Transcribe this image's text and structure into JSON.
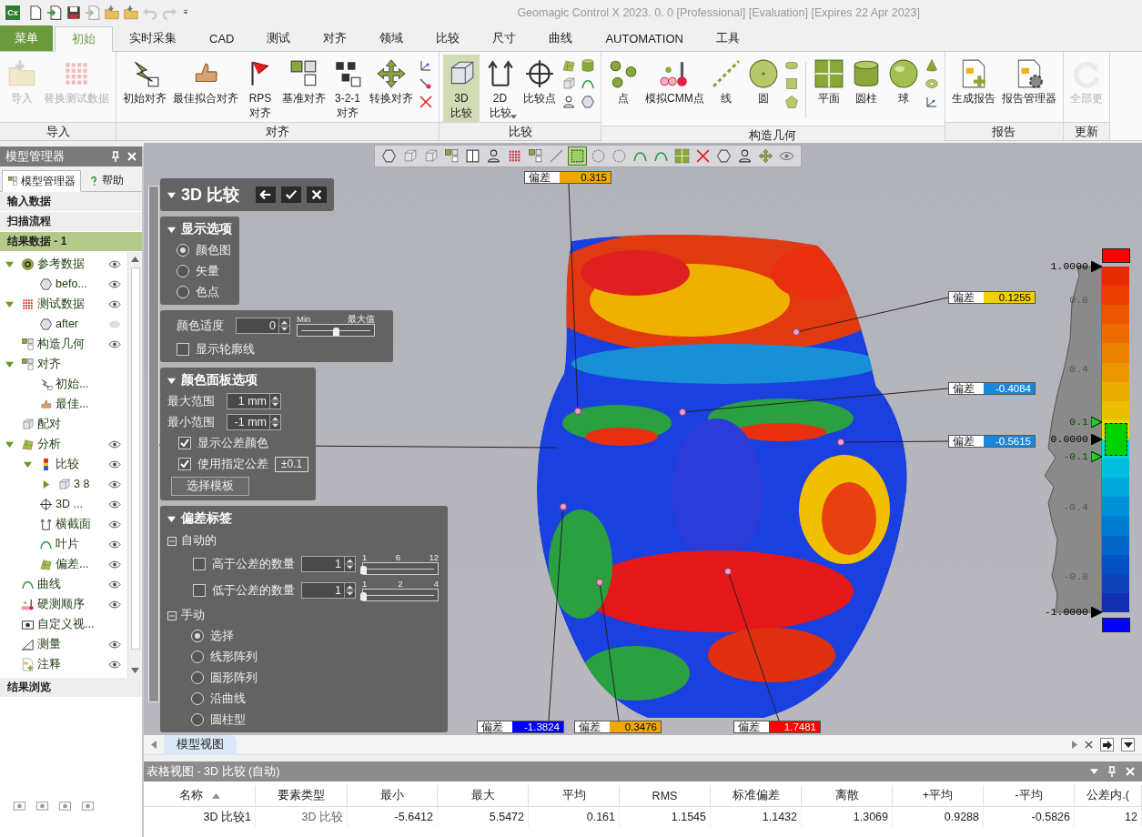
{
  "window": {
    "title": "Geomagic Control X 2023. 0. 0 [Professional] [Evaluation] [Expires 22 Apr 2023]",
    "logo": "Cx"
  },
  "quick_access": [
    {
      "disabled": false
    },
    {
      "disabled": false
    },
    {
      "disabled": false
    },
    {
      "disabled": true
    },
    {
      "disabled": false
    },
    {
      "disabled": false
    },
    {
      "disabled": true
    },
    {
      "disabled": true
    },
    {
      "disabled": false
    }
  ],
  "menu_tabs": [
    {
      "label": "菜单",
      "kind": "menu",
      "selected": false
    },
    {
      "label": "初始",
      "kind": "tab",
      "selected": true
    },
    {
      "label": "实时采集",
      "kind": "tab",
      "selected": false
    },
    {
      "label": "CAD",
      "kind": "tab",
      "selected": false
    },
    {
      "label": "测试",
      "kind": "tab",
      "selected": false
    },
    {
      "label": "对齐",
      "kind": "tab",
      "selected": false
    },
    {
      "label": "领域",
      "kind": "tab",
      "selected": false
    },
    {
      "label": "比较",
      "kind": "tab",
      "selected": false
    },
    {
      "label": "尺寸",
      "kind": "tab",
      "selected": false
    },
    {
      "label": "曲线",
      "kind": "tab",
      "selected": false
    },
    {
      "label": "AUTOMATION",
      "kind": "tab",
      "selected": false
    },
    {
      "label": "工具",
      "kind": "tab",
      "selected": false
    }
  ],
  "ribbon": [
    {
      "title": "导入",
      "items": [
        {
          "kind": "button",
          "label": "导入",
          "disabled": true,
          "selected": false,
          "dropdown": false
        },
        {
          "kind": "button",
          "label": "替换测试数据",
          "disabled": true,
          "selected": false,
          "dropdown": false
        }
      ]
    },
    {
      "title": "对齐",
      "items": [
        {
          "kind": "button",
          "label": "初始对齐",
          "disabled": false,
          "selected": false,
          "dropdown": false
        },
        {
          "kind": "button",
          "label": "最佳拟合对齐",
          "disabled": false,
          "selected": false,
          "dropdown": false
        },
        {
          "kind": "button",
          "label": "RPS\n对齐",
          "disabled": false,
          "selected": false,
          "dropdown": false
        },
        {
          "kind": "button",
          "label": "基准对齐",
          "disabled": false,
          "selected": false,
          "dropdown": false
        },
        {
          "kind": "button",
          "label": "3-2-1\n对齐",
          "disabled": false,
          "selected": false,
          "dropdown": false
        },
        {
          "kind": "button",
          "label": "转换对齐",
          "disabled": false,
          "selected": false,
          "dropdown": false
        },
        {
          "kind": "stack"
        }
      ]
    },
    {
      "title": "比较",
      "items": [
        {
          "kind": "button",
          "label": "3D\n比较",
          "disabled": false,
          "selected": true,
          "dropdown": false
        },
        {
          "kind": "button",
          "label": "2D\n比较",
          "disabled": false,
          "selected": false,
          "dropdown": true
        },
        {
          "kind": "button",
          "label": "比较点",
          "disabled": false,
          "selected": false,
          "dropdown": false
        },
        {
          "kind": "stack"
        },
        {
          "kind": "stack"
        }
      ]
    },
    {
      "title": "构造几何",
      "items": [
        {
          "kind": "button",
          "label": "点",
          "disabled": false,
          "selected": false,
          "dropdown": false
        },
        {
          "kind": "button",
          "label": "模拟CMM点",
          "disabled": false,
          "selected": false,
          "dropdown": false
        },
        {
          "kind": "button",
          "label": "线",
          "disabled": false,
          "selected": false,
          "dropdown": false
        },
        {
          "kind": "button",
          "label": "圆",
          "disabled": false,
          "selected": false,
          "dropdown": false
        },
        {
          "kind": "stack"
        },
        {
          "kind": "separator"
        },
        {
          "kind": "button",
          "label": "平面",
          "disabled": false,
          "selected": false,
          "dropdown": false
        },
        {
          "kind": "button",
          "label": "圆柱",
          "disabled": false,
          "selected": false,
          "dropdown": false
        },
        {
          "kind": "button",
          "label": "球",
          "disabled": false,
          "selected": false,
          "dropdown": false
        },
        {
          "kind": "stack"
        }
      ]
    },
    {
      "title": "报告",
      "items": [
        {
          "kind": "button",
          "label": "生成报告",
          "disabled": false,
          "selected": false,
          "dropdown": false
        },
        {
          "kind": "button",
          "label": "报告管理器",
          "disabled": false,
          "selected": false,
          "dropdown": false
        }
      ]
    },
    {
      "title": "更新",
      "items": [
        {
          "kind": "button",
          "label": "全部更",
          "disabled": true,
          "selected": false,
          "dropdown": false
        }
      ]
    }
  ],
  "model_manager": {
    "title": "模型管理器",
    "tabs": [
      {
        "label": "模型管理器",
        "selected": true
      },
      {
        "label": "帮助",
        "selected": false
      }
    ],
    "sections": [
      {
        "label": "输入数据",
        "selected": false
      },
      {
        "label": "扫描流程",
        "selected": false
      },
      {
        "label": "结果数据 - 1",
        "selected": true
      }
    ],
    "tree": [
      {
        "label": "参考数据",
        "expanded": true,
        "visible": true,
        "children": [
          {
            "label": "befo...",
            "visible": true
          }
        ]
      },
      {
        "label": "测试数据",
        "expanded": true,
        "visible": true,
        "children": [
          {
            "label": "after",
            "visible": false
          }
        ]
      },
      {
        "label": "构造几何",
        "visible": true
      },
      {
        "label": "对齐",
        "expanded": true,
        "children": [
          {
            "label": "初始..."
          },
          {
            "label": "最佳..."
          }
        ]
      },
      {
        "label": "配对"
      },
      {
        "label": "分析",
        "expanded": true,
        "visible": true,
        "children": [
          {
            "label": "比较",
            "expanded": true,
            "visible": true,
            "children": [
              {
                "label": "3 8",
                "expanded": false,
                "visible": true
              }
            ]
          },
          {
            "label": "3D ...",
            "visible": true
          },
          {
            "label": "横截面",
            "visible": true
          },
          {
            "label": "叶片",
            "visible": true
          },
          {
            "label": "偏差...",
            "visible": true
          }
        ]
      },
      {
        "label": "曲线",
        "visible": true
      },
      {
        "label": "硬测顺序",
        "visible": true
      },
      {
        "label": "自定义视..."
      },
      {
        "label": "测量",
        "visible": true
      },
      {
        "label": "注释",
        "visible": true
      }
    ],
    "browser_title": "结果浏览"
  },
  "viewport_toolbar": [
    {
      "selected": false
    },
    {
      "selected": false
    },
    {
      "selected": false
    },
    {
      "selected": false
    },
    {
      "selected": false
    },
    {
      "selected": false
    },
    {
      "selected": false
    },
    {
      "selected": false
    },
    {
      "selected": false
    },
    {
      "selected": true
    },
    {
      "selected": false
    },
    {
      "selected": false
    },
    {
      "selected": false
    },
    {
      "selected": false
    },
    {
      "selected": false
    },
    {
      "selected": false
    },
    {
      "selected": false
    },
    {
      "selected": false
    },
    {
      "selected": false
    },
    {
      "selected": false
    }
  ],
  "compare_panel": {
    "title": "3D 比较",
    "display": {
      "title": "显示选项",
      "options": [
        {
          "label": "颜色图",
          "selected": true
        },
        {
          "label": "矢量",
          "selected": false
        },
        {
          "label": "色点",
          "selected": false
        }
      ]
    },
    "appearance": {
      "label": "颜色适度",
      "value": "0",
      "slider_min": "Min",
      "slider_max": "最大值",
      "level": 0.5,
      "outline": {
        "label": "显示轮廓线",
        "checked": false
      }
    },
    "palette": {
      "title": "颜色面板选项",
      "max_label": "最大范围",
      "max_value": "1 mm",
      "min_label": "最小范围",
      "min_value": "-1 mm",
      "checks": [
        {
          "label": "显示公差颜色",
          "checked": true
        },
        {
          "label": "使用指定公差",
          "checked": true,
          "value": "±0.1"
        }
      ],
      "template_button": "选择模板"
    },
    "labels": {
      "title": "偏差标签",
      "auto": {
        "title": "自动的",
        "expanded": true,
        "rows": [
          {
            "label": "高于公差的数量",
            "checked": false,
            "value": "1",
            "ticks": [
              "1",
              "6",
              "12"
            ],
            "level": 0
          },
          {
            "label": "低于公差的数量",
            "checked": false,
            "value": "1",
            "ticks": [
              "1",
              "2",
              "4"
            ],
            "level": 0
          }
        ]
      },
      "manual": {
        "title": "手动",
        "expanded": true,
        "options": [
          {
            "label": "选择",
            "selected": true
          },
          {
            "label": "线形阵列",
            "selected": false
          },
          {
            "label": "圆形阵列",
            "selected": false
          },
          {
            "label": "沿曲线",
            "selected": false
          },
          {
            "label": "圆柱型",
            "selected": false
          }
        ]
      }
    }
  },
  "deviation_labels": [
    {
      "caption": "偏差",
      "value": "0.315",
      "color": "#f0a800"
    },
    {
      "caption": "偏差",
      "value": "0.1255",
      "color": "#f0d000"
    },
    {
      "caption": "偏差",
      "value": "-0.4084",
      "color": "#1a86dc"
    },
    {
      "caption": "偏差",
      "value": "-0.5615",
      "color": "#1a86dc"
    },
    {
      "caption": "偏差",
      "value": "-1.3824",
      "color": "#0000ff"
    },
    {
      "caption": "偏差",
      "value": "0.3476",
      "color": "#f0a800"
    },
    {
      "caption": "偏差",
      "value": "1.7481",
      "color": "#ff0000"
    }
  ],
  "color_scale": {
    "segments": [
      {
        "color": "#e82c00"
      },
      {
        "color": "#ea3e00"
      },
      {
        "color": "#ec5600"
      },
      {
        "color": "#ec6a00"
      },
      {
        "color": "#ec8200"
      },
      {
        "color": "#ec9600"
      },
      {
        "color": "#ecac00"
      },
      {
        "color": "#ecc000"
      },
      {
        "color": "#ecd800"
      },
      {
        "color": "#00d8e2"
      },
      {
        "color": "#00bedc"
      },
      {
        "color": "#00a8dc"
      },
      {
        "color": "#0090d6"
      },
      {
        "color": "#007cd0"
      },
      {
        "color": "#0066c8"
      },
      {
        "color": "#0052c0"
      },
      {
        "color": "#1042b8"
      },
      {
        "color": "#1030b0"
      }
    ],
    "ticks": [
      {
        "label": "1.0000",
        "kind": "limit"
      },
      {
        "label": "0.8",
        "kind": "minor"
      },
      {
        "label": "0.4",
        "kind": "minor"
      },
      {
        "label": "0.1",
        "kind": "tolerance"
      },
      {
        "label": "0.0000",
        "kind": "limit"
      },
      {
        "label": "-0.1",
        "kind": "tolerance"
      },
      {
        "label": "-0.4",
        "kind": "minor"
      },
      {
        "label": "-0.8",
        "kind": "minor"
      },
      {
        "label": "-1.0000",
        "kind": "limit"
      }
    ]
  },
  "view_tabs": [
    {
      "label": "模型视图",
      "selected": true
    }
  ],
  "table_view": {
    "title": "表格视图 - 3D 比较 (自动)",
    "columns": [
      {
        "label": "名称",
        "sorted": true
      },
      {
        "label": "要素类型",
        "sorted": false
      },
      {
        "label": "最小",
        "sorted": false
      },
      {
        "label": "最大",
        "sorted": false
      },
      {
        "label": "平均",
        "sorted": false
      },
      {
        "label": "RMS",
        "sorted": false
      },
      {
        "label": "标准偏差",
        "sorted": false
      },
      {
        "label": "离散",
        "sorted": false
      },
      {
        "label": "+平均",
        "sorted": false
      },
      {
        "label": "-平均",
        "sorted": false
      },
      {
        "label": "公差内.(",
        "sorted": false
      }
    ],
    "rows": [
      [
        "3D 比较1",
        "3D 比较",
        "-5.6412",
        "5.5472",
        "0.161",
        "1.1545",
        "1.1432",
        "1.3069",
        "0.9288",
        "-0.5826",
        "12"
      ]
    ]
  }
}
